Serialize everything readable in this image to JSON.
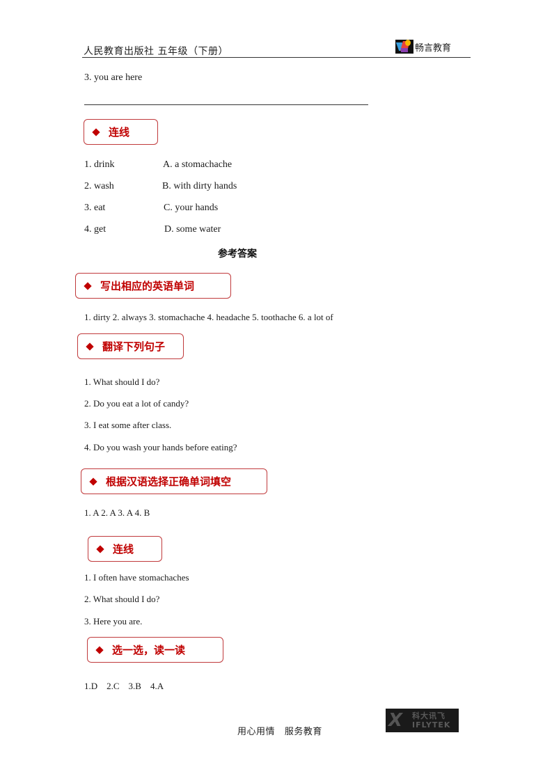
{
  "header": {
    "left": "人民教育出版社 五年级（下册）",
    "brand": "畅言教育",
    "logo_icon": "colorful-bird-logo"
  },
  "top": {
    "item3": "3. you are here"
  },
  "section_match": {
    "title": "连线",
    "left": [
      "1. drink",
      "2. wash",
      "3. eat",
      "4. get"
    ],
    "right": [
      "A. a stomachache",
      "B. with dirty hands",
      "C. your hands",
      "D. some water"
    ]
  },
  "answers_heading": "参考答案",
  "answers": {
    "s1": {
      "title": "写出相应的英语单词",
      "text": "1. dirty 2. always 3. stomachache 4. headache 5. toothache 6. a lot of"
    },
    "s2": {
      "title": "翻译下列句子",
      "items": [
        "1. What should I do?",
        "2. Do you eat a lot of candy?",
        "3. I eat some after class.",
        "4. Do you wash your hands before eating?"
      ]
    },
    "s3": {
      "title": "根据汉语选择正确单词填空",
      "text": "1. A 2. A 3. A 4. B"
    },
    "s4": {
      "title": "连线",
      "items": [
        "1. I often have stomachaches",
        "2. What should I do?",
        "3. Here you are."
      ]
    },
    "s5": {
      "title": "选一选，读一读",
      "text": "1.D    2.C    3.B    4.A"
    }
  },
  "footer": {
    "slogan": "用心用情   服务教育",
    "logo_cn": "科大讯飞",
    "logo_en": "IFLYTEK"
  },
  "colors": {
    "accent": "#c00000",
    "box_border": "#c0393b"
  }
}
